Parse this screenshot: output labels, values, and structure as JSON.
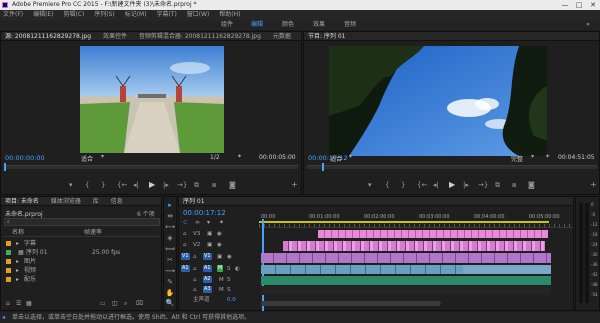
{
  "window": {
    "title": "Adobe Premiere Pro CC 2015 - F:\\新建文件夹 (3)\\未命名.prproj *",
    "minimize": "—",
    "maximize": "□",
    "close": "✕"
  },
  "menu": [
    "文件(F)",
    "编辑(E)",
    "剪辑(C)",
    "序列(S)",
    "标记(M)",
    "字幕(T)",
    "窗口(W)",
    "帮助(H)"
  ],
  "workspaces": [
    {
      "label": "组件",
      "active": false
    },
    {
      "label": "编辑",
      "active": true
    },
    {
      "label": "颜色",
      "active": false
    },
    {
      "label": "效果",
      "active": false
    },
    {
      "label": "音频",
      "active": false
    }
  ],
  "source": {
    "tabs": [
      "源: 20081211162829278.jpg",
      "效果控件",
      "音频剪辑混合器: 20081211162829278.jpg",
      "元数据"
    ],
    "timecode_left": "00:00:00:00",
    "fit": "适合",
    "page": "1/2",
    "timecode_right": "00:00:05:00"
  },
  "program": {
    "tab": "节目: 序列 01",
    "timecode_left": "00:00:17:12",
    "fit": "适合",
    "quality": "完整",
    "timecode_right": "00:04:51:05"
  },
  "project": {
    "tabs": [
      "项目: 未命名",
      "媒体浏览器",
      "库",
      "信息"
    ],
    "file": "未命名.prproj",
    "count": "6 个项",
    "col_name": "名称",
    "col_rate": "帧速率",
    "rows": [
      {
        "name": "字幕",
        "rate": "",
        "color": "#e0a020"
      },
      {
        "name": "序列 01",
        "rate": "25.00 fps",
        "color": "#3fae5f"
      },
      {
        "name": "图片",
        "rate": "",
        "color": "#e0a020"
      },
      {
        "name": "视频",
        "rate": "",
        "color": "#e0a020"
      },
      {
        "name": "配乐",
        "rate": "",
        "color": "#e0a020"
      }
    ]
  },
  "timeline": {
    "tab": "序列 01",
    "timecode": "00:00:17:12",
    "ruler": [
      "00:00",
      "00:01:00:00",
      "00:02:00:00",
      "00:03:00:00",
      "00:04:00:00",
      "00:05:00:00"
    ],
    "video_tracks": [
      "V3",
      "V2",
      "V1"
    ],
    "audio_tracks": [
      "A1",
      "A2",
      "A3"
    ],
    "master": "主声道",
    "master_value": "0.0",
    "v1_source": "V1",
    "a1_source": "A1"
  },
  "tools": [
    "▸",
    "⇹",
    "⟷",
    "◈",
    "⟺",
    "✂",
    "⟿",
    "✎",
    "✋",
    "🔍"
  ],
  "meter_scale": [
    "0",
    "-6",
    "-12",
    "-18",
    "-24",
    "-30",
    "-36",
    "-42",
    "-48",
    "-54"
  ],
  "status": "单击以选择，或单击空白处并拖动以进行框选。使用 Shift、Alt 和 Ctrl 可获得其他选项。"
}
